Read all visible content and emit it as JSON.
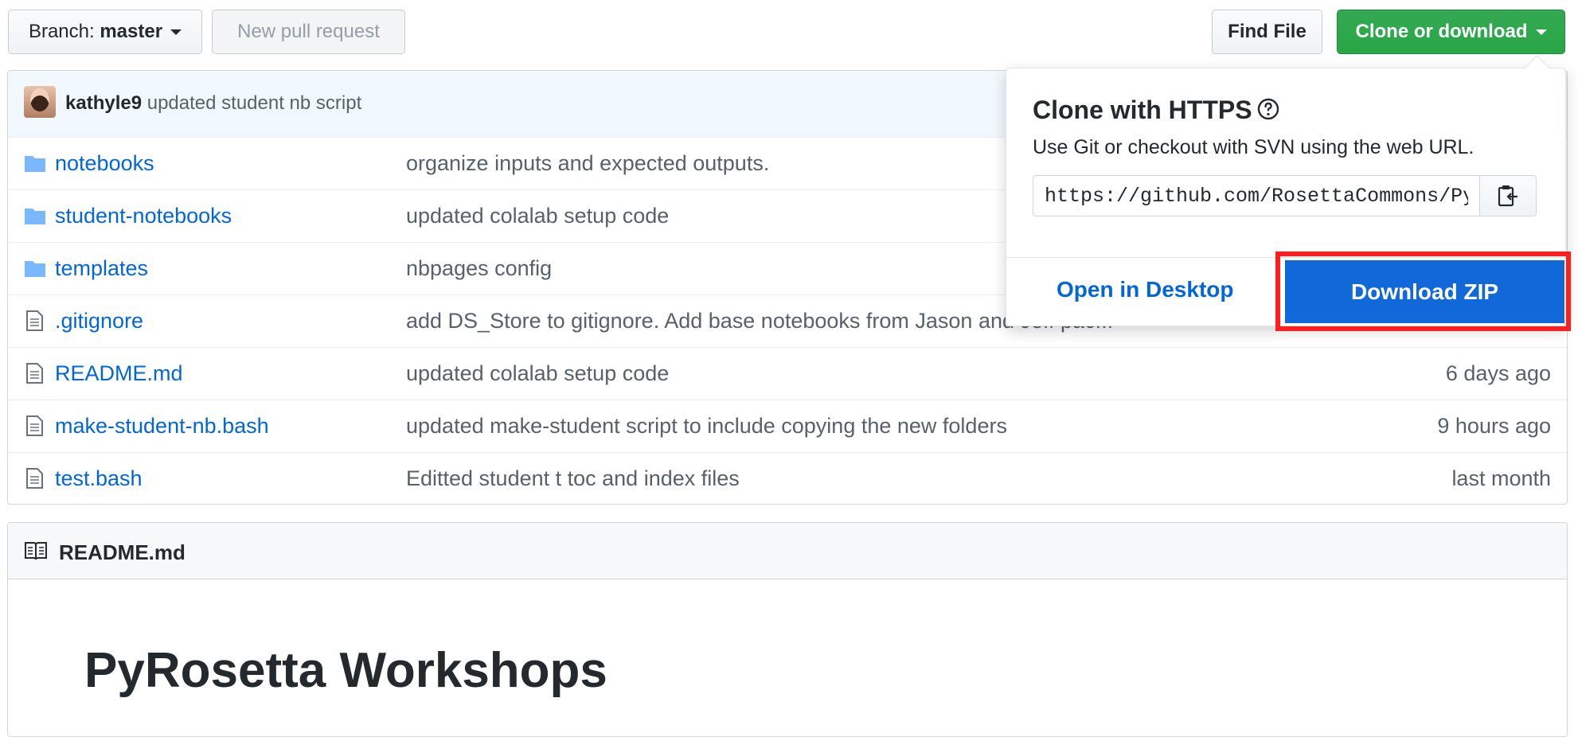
{
  "toolbar": {
    "branch_prefix": "Branch:",
    "branch_name": "master",
    "new_pr_label": "New pull request",
    "find_file_label": "Find File",
    "clone_label": "Clone or download"
  },
  "commit": {
    "author": "kathyle9",
    "message": "updated student nb script"
  },
  "files": [
    {
      "type": "folder",
      "name": "notebooks",
      "message": "organize inputs and expected outputs.",
      "age": ""
    },
    {
      "type": "folder",
      "name": "student-notebooks",
      "message": "updated colalab setup code",
      "age": ""
    },
    {
      "type": "folder",
      "name": "templates",
      "message": "nbpages config",
      "age": ""
    },
    {
      "type": "file",
      "name": ".gitignore",
      "message": "add DS_Store to gitignore. Add base notebooks from Jason and Jeff pac...",
      "age": ""
    },
    {
      "type": "file",
      "name": "README.md",
      "message": "updated colalab setup code",
      "age": "6 days ago"
    },
    {
      "type": "file",
      "name": "make-student-nb.bash",
      "message": "updated make-student script to include copying the new folders",
      "age": "9 hours ago"
    },
    {
      "type": "file",
      "name": "test.bash",
      "message": "Editted student t toc and index files",
      "age": "last month"
    }
  ],
  "readme": {
    "filename": "README.md",
    "heading": "PyRosetta Workshops"
  },
  "clone_dropdown": {
    "title": "Clone with HTTPS",
    "description": "Use Git or checkout with SVN using the web URL.",
    "url": "https://github.com/RosettaCommons/PyRosetta.notebooks.git",
    "open_desktop_label": "Open in Desktop",
    "download_zip_label": "Download ZIP"
  },
  "colors": {
    "link": "#0366d6",
    "green": "#28a745",
    "download_blue": "#1168d8",
    "highlight_red": "#ff1f1f"
  }
}
